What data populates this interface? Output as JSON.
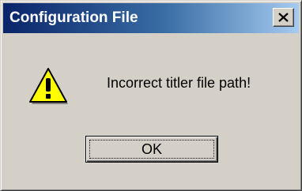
{
  "dialog": {
    "title": "Configuration File",
    "close_icon": "close-icon",
    "message_icon": "warning-icon",
    "message": "Incorrect titler file path!",
    "ok_label": "OK"
  },
  "colors": {
    "face": "#d4d0c8",
    "title_start": "#0a246a",
    "title_end": "#a6caf0",
    "warning_yellow": "#ffff00"
  }
}
